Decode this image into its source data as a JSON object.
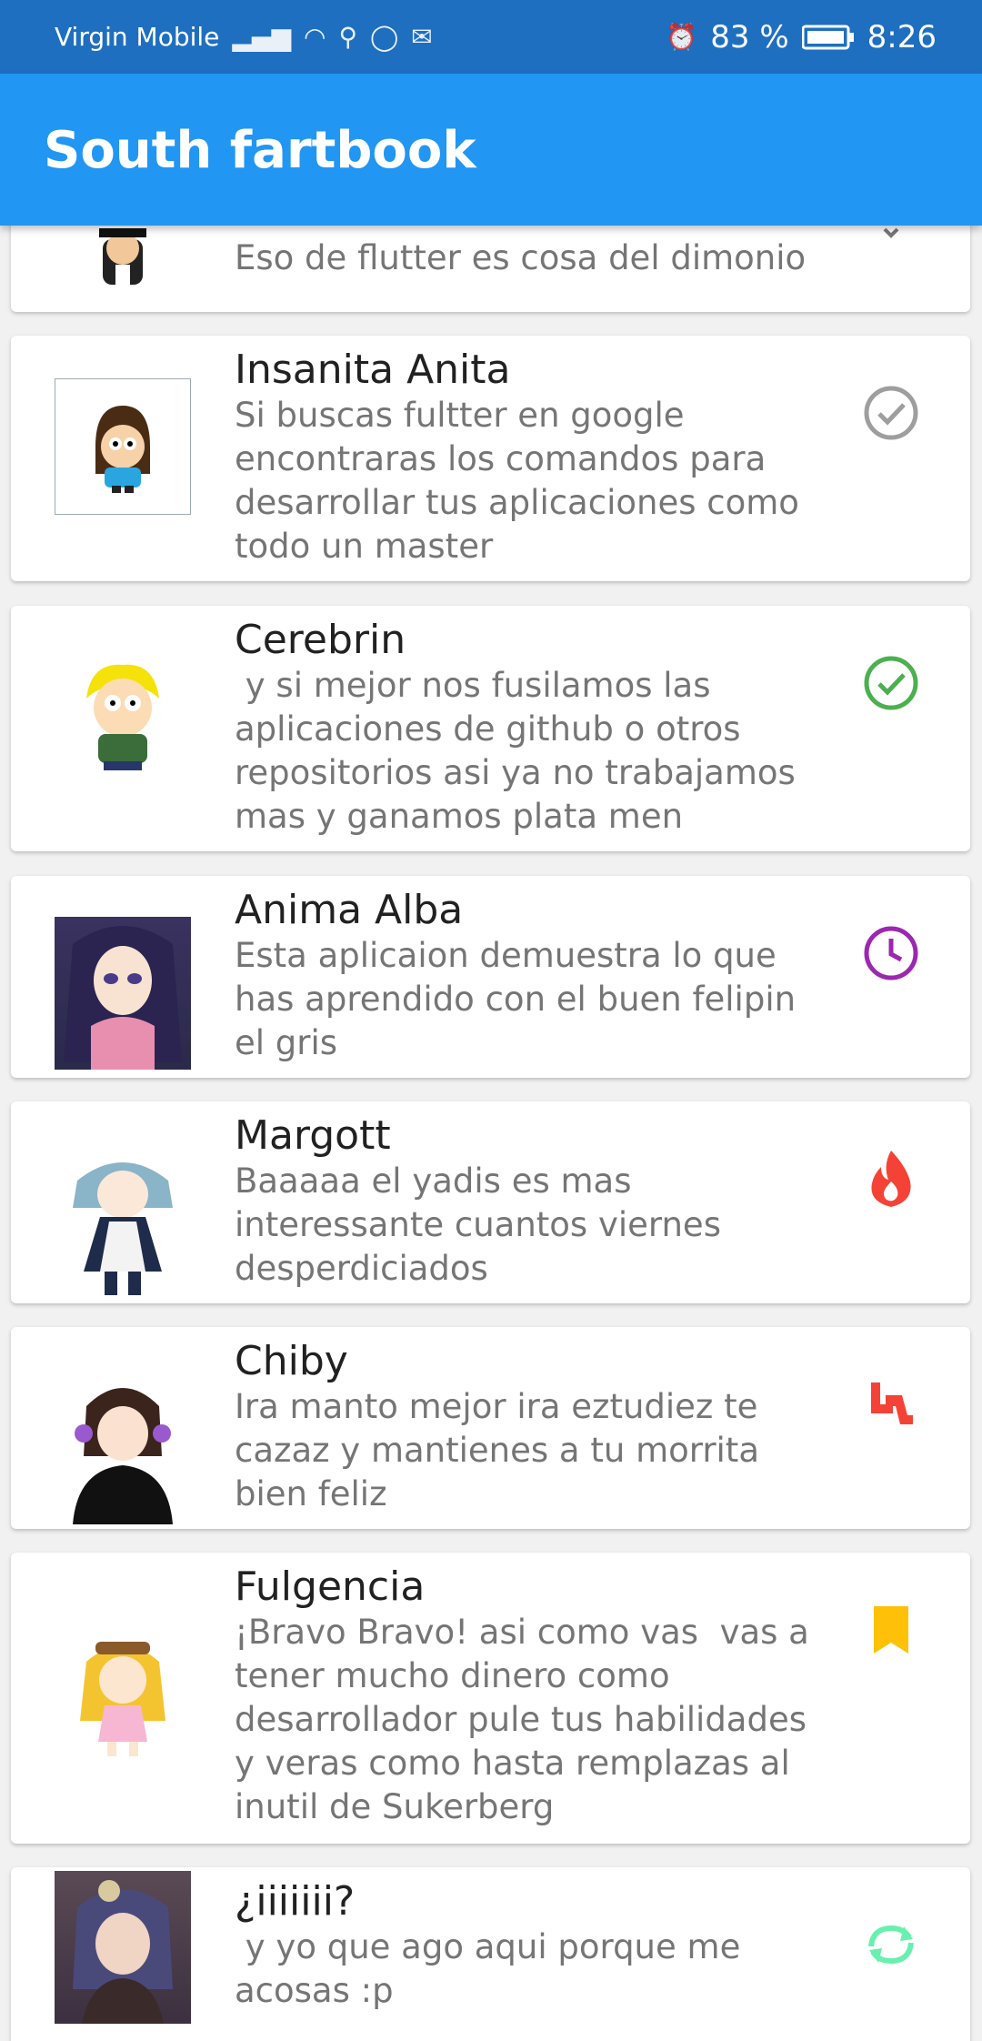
{
  "status_bar": {
    "carrier": "Virgin Mobile",
    "battery": "83 %",
    "time": "8:26"
  },
  "app_bar": {
    "title": "South fartbook"
  },
  "colors": {
    "status_bar": "#1e6fc0",
    "app_bar": "#2196f3",
    "grey_check": "#9e9e9e",
    "green_check": "#4caf50",
    "purple_clock": "#9c27b0",
    "red": "#f44336",
    "amber": "#ffc107",
    "teal_sync": "#69f0ae"
  },
  "messages": [
    {
      "name": "",
      "text": "Eso de flutter es cosa del dimonio",
      "icon": "chevron-icon"
    },
    {
      "name": "Insanita Anita",
      "text": "Si buscas fultter en google encontraras los comandos para desarrollar tus aplicaciones como todo un master",
      "icon": "check-circle-outline-icon"
    },
    {
      "name": "Cerebrin",
      "text": " y si mejor nos fusilamos las aplicaciones de github o otros repositorios asi ya no trabajamos mas y ganamos plata men",
      "icon": "check-circle-green-icon"
    },
    {
      "name": "Anima Alba",
      "text": "Esta aplicaion demuestra lo que has aprendido con el buen felipin el gris",
      "icon": "clock-icon"
    },
    {
      "name": "Margott",
      "text": "Baaaaa el yadis es mas interessante cuantos viernes desperdiciados",
      "icon": "fire-icon"
    },
    {
      "name": "Chiby",
      "text": "Ira manto mejor ira eztudiez te cazaz y mantienes a tu morrita bien feliz",
      "icon": "seat-icon"
    },
    {
      "name": "Fulgencia",
      "text": "¡Bravo Bravo! asi como vas  vas a tener mucho dinero como desarrollador pule tus habilidades y veras como hasta remplazas al inutil de Sukerberg",
      "icon": "bookmark-icon"
    },
    {
      "name": "¿iiiiiii?",
      "text": " y yo que ago aqui porque me acosas :p",
      "icon": "sync-icon"
    }
  ]
}
